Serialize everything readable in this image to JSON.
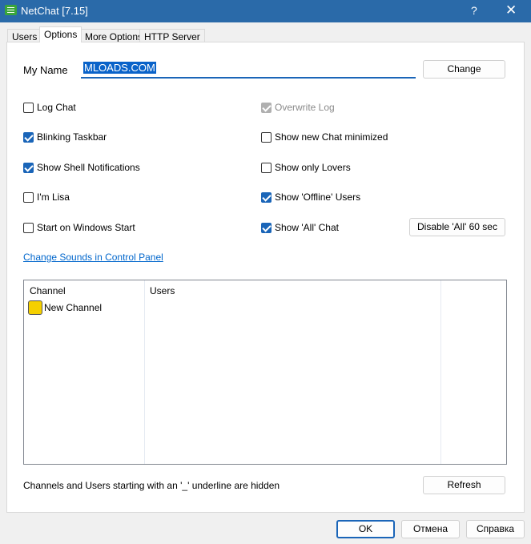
{
  "window": {
    "title": "NetChat [7.15]",
    "help": "?",
    "close": "✕"
  },
  "tabs": [
    "Users",
    "Options",
    "More Options",
    "HTTP Server"
  ],
  "name": {
    "label": "My Name",
    "value": "MLOADS.COM",
    "change": "Change"
  },
  "checkboxes": [
    {
      "label": "Log Chat",
      "checked": false
    },
    {
      "label": "Overwrite Log",
      "checked": true,
      "disabled": true
    },
    {
      "label": "Blinking Taskbar",
      "checked": true
    },
    {
      "label": "Show new Chat minimized",
      "checked": false
    },
    {
      "label": "Show Shell Notifications",
      "checked": true
    },
    {
      "label": "Show only Lovers",
      "checked": false
    },
    {
      "label": "I'm Lisa",
      "checked": false
    },
    {
      "label": "Show 'Offline' Users",
      "checked": true
    },
    {
      "label": "Start on Windows Start",
      "checked": false
    },
    {
      "label": "Show 'All' Chat",
      "checked": true
    }
  ],
  "disable_all": "Disable 'All' 60 sec",
  "sounds_link": "Change Sounds in Control Panel",
  "list": {
    "headers": [
      "Channel",
      "Users"
    ],
    "rows": [
      {
        "channel": "New Channel",
        "icon": "bart-avatar-icon"
      }
    ]
  },
  "hint": "Channels and Users starting with an '_' underline are hidden",
  "refresh": "Refresh",
  "footer": {
    "ok": "OK",
    "cancel": "Отмена",
    "help": "Справка"
  }
}
